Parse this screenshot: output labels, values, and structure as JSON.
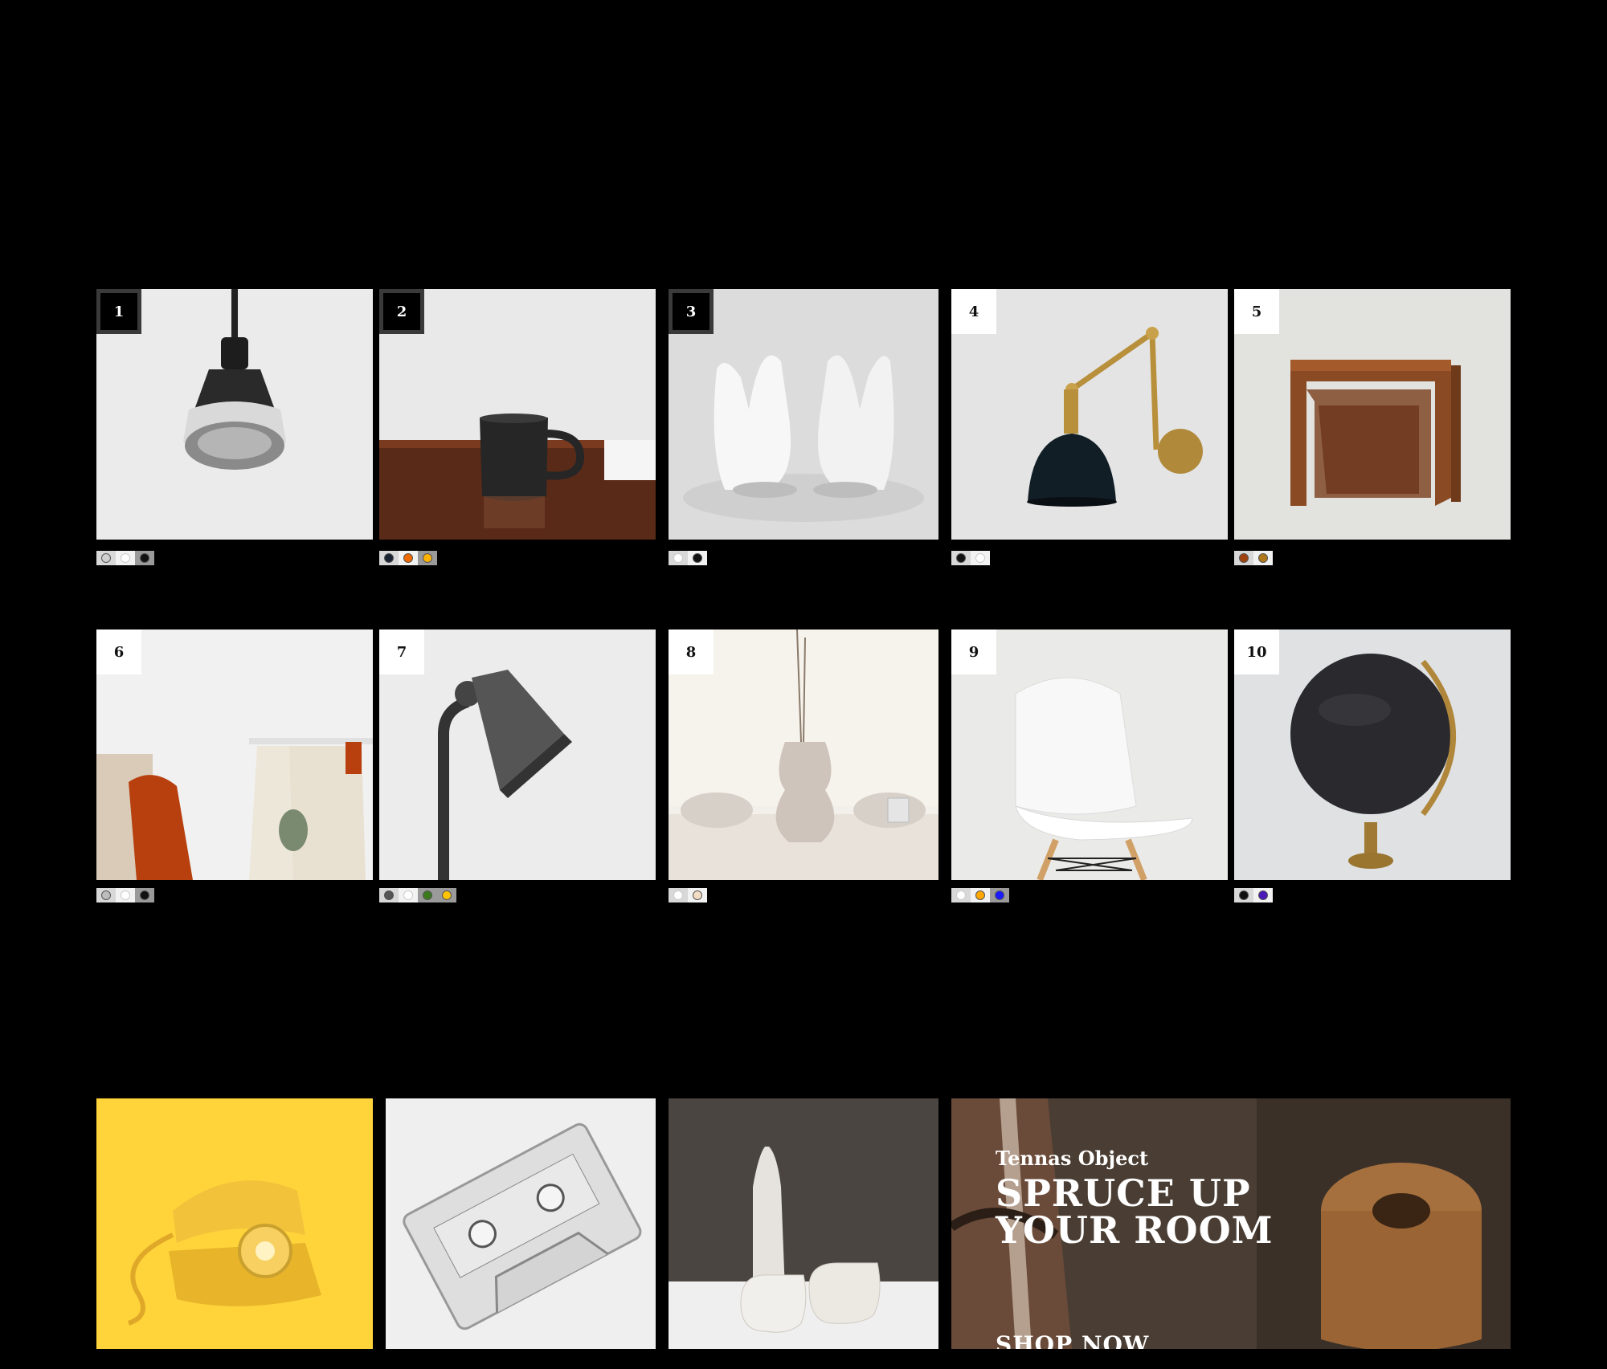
{
  "products": [
    {
      "rank": "1",
      "badge": "dark",
      "swatches": [
        "#cfcfcf",
        "#ffffff",
        "#111111"
      ],
      "image": "pendant-lamp"
    },
    {
      "rank": "2",
      "badge": "dark",
      "swatches": [
        "#1a2333",
        "#f06a00",
        "#ffb300"
      ],
      "image": "black-mug"
    },
    {
      "rank": "3",
      "badge": "dark",
      "swatches": [
        "#ffffff",
        "#111111"
      ],
      "image": "ceramic-hands"
    },
    {
      "rank": "4",
      "badge": "light",
      "swatches": [
        "#111111",
        "#ffffff"
      ],
      "image": "brass-wall-lamp"
    },
    {
      "rank": "5",
      "badge": "light",
      "swatches": [
        "#a0420e",
        "#b07a1c"
      ],
      "image": "nesting-tables"
    },
    {
      "rank": "6",
      "badge": "light",
      "swatches": [
        "#bdbdbd",
        "#ffffff",
        "#111111"
      ],
      "image": "clothing-rack"
    },
    {
      "rank": "7",
      "badge": "light",
      "swatches": [
        "#555555",
        "#ffffff",
        "#3b7a1c",
        "#ffc400"
      ],
      "image": "floor-lamp"
    },
    {
      "rank": "8",
      "badge": "light",
      "swatches": [
        "#ffffff",
        "#f3dcc3"
      ],
      "image": "ceramic-vase"
    },
    {
      "rank": "9",
      "badge": "light",
      "swatches": [
        "#ffffff",
        "#ffa600",
        "#1a1aff"
      ],
      "image": "white-chair"
    },
    {
      "rank": "10",
      "badge": "light",
      "swatches": [
        "#111111",
        "#4a1ab8"
      ],
      "image": "black-globe"
    }
  ],
  "bottom_tiles": [
    {
      "image": "yellow-telephone"
    },
    {
      "image": "cassette-tape"
    },
    {
      "image": "ceramic-bottle-cups"
    }
  ],
  "promo": {
    "brand": "Tennas Object",
    "title": "SPRUCE UP YOUR ROOM",
    "cta": "SHOP NOW"
  }
}
